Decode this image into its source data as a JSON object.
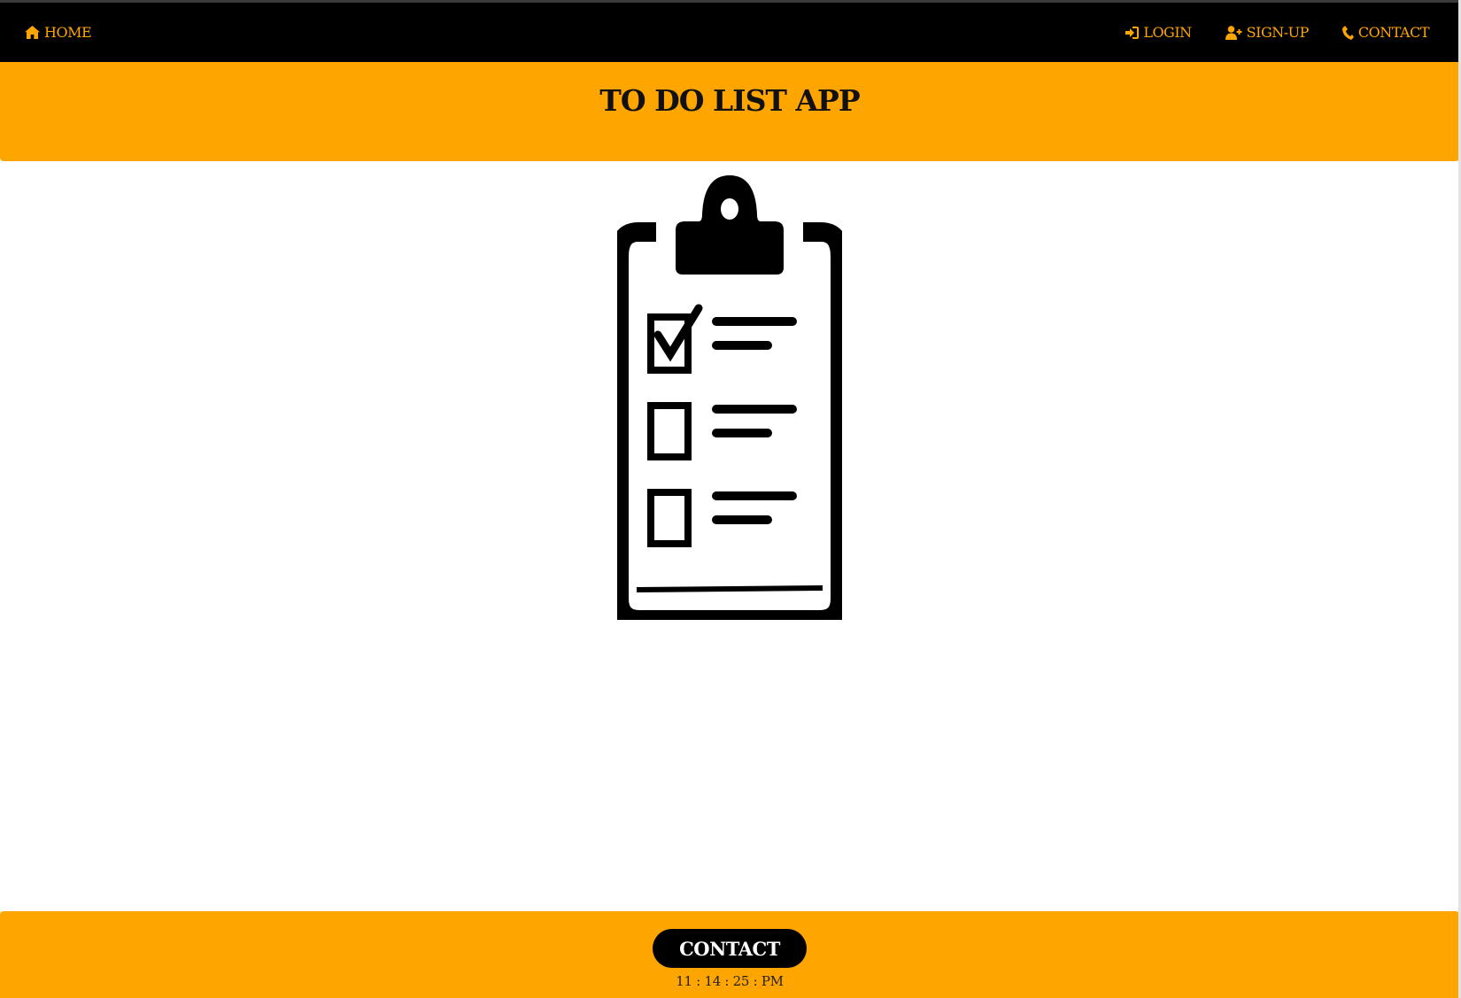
{
  "nav": {
    "home_label": "HOME",
    "login_label": "LOGIN",
    "signup_label": "SIGN-UP",
    "contact_label": "CONTACT",
    "icons": [
      "home-icon",
      "sign-in-icon",
      "user-plus-icon",
      "phone-icon"
    ]
  },
  "header": {
    "title": "TO DO LIST APP"
  },
  "hero": {
    "image": "clipboard-checklist-icon",
    "checkboxes": [
      true,
      false,
      false
    ]
  },
  "footer": {
    "contact_button": "CONTACT",
    "clock": "11 : 14 : 25 : PM"
  },
  "colors": {
    "navbar_bg": "#000000",
    "accent": "#ffa500",
    "button_bg": "#000000",
    "button_text": "#ffffff",
    "page_bg": "#ffffff"
  }
}
